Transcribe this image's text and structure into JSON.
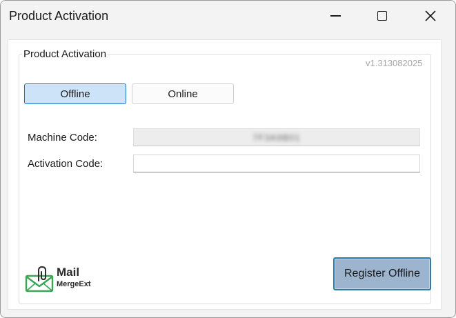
{
  "window": {
    "title": "Product Activation",
    "minimize_icon": "minimize-icon",
    "maximize_icon": "maximize-icon",
    "close_icon": "close-icon"
  },
  "group": {
    "legend": "Product Activation",
    "version": "v1.313082025"
  },
  "tabs": [
    {
      "label": "Offline",
      "selected": true
    },
    {
      "label": "Online",
      "selected": false
    }
  ],
  "form": {
    "machine_code_label": "Machine Code:",
    "machine_code_value": "7F3A9B01",
    "activation_code_label": "Activation Code:",
    "activation_code_value": ""
  },
  "logo": {
    "icon": "mail-envelope-icon",
    "main": "Mail",
    "sub": "MergeExt",
    "color": "#3aa655"
  },
  "actions": {
    "register_label": "Register Offline"
  },
  "colors": {
    "accent": "#1f6fbf",
    "selected_tab_bg": "#cde3f7",
    "register_bg": "#9db4cf"
  }
}
